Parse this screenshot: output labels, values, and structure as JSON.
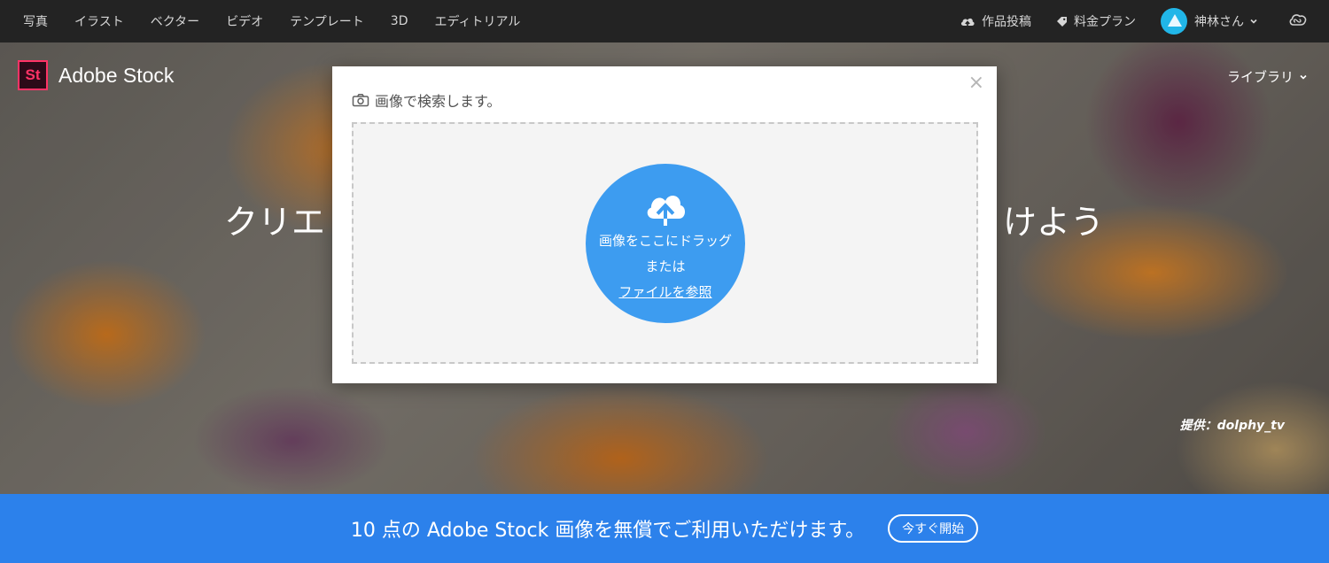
{
  "nav": {
    "items": [
      "写真",
      "イラスト",
      "ベクター",
      "ビデオ",
      "テンプレート",
      "3D",
      "エディトリアル"
    ],
    "upload_label": "作品投稿",
    "pricing_label": "料金プラン",
    "user_label": "神林さん"
  },
  "brand": {
    "logo_mark": "St",
    "name": "Adobe Stock"
  },
  "hero": {
    "library_label": "ライブラリ",
    "title_left": "クリエ",
    "title_right": "けよう",
    "credit": "提供：dolphy_tv"
  },
  "modal": {
    "heading": "画像で検索します。",
    "close_glyph": "×",
    "drop_line1": "画像をここにドラッグ",
    "drop_line2": "または",
    "browse_link": "ファイルを参照"
  },
  "banner": {
    "text": "10 点の Adobe Stock 画像を無償でご利用いただけます。",
    "button_label": "今すぐ開始"
  },
  "colors": {
    "nav_bg": "#232323",
    "banner_bg": "#2c81eb",
    "upload_circle": "#3d9cf0",
    "logo_accent": "#ff3366",
    "avatar": "#21b6e8"
  }
}
